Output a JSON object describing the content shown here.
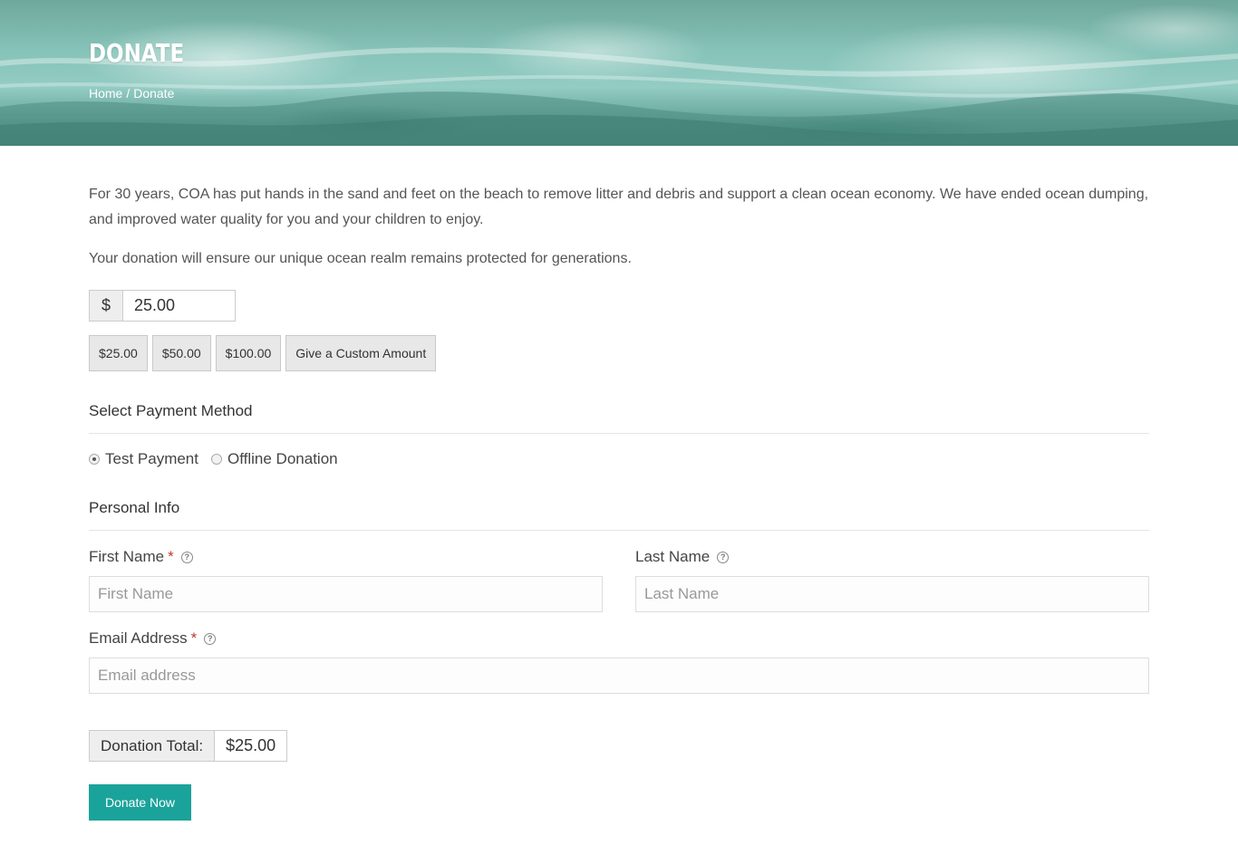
{
  "hero": {
    "title": "DONATE",
    "breadcrumb": {
      "home": "Home",
      "separator": "/",
      "current": "Donate"
    }
  },
  "intro": {
    "paragraph1": "For 30 years, COA has put hands in the sand and feet on the beach to remove litter and debris and support a clean ocean economy. We have ended ocean dumping, and improved water quality for you and your children to enjoy.",
    "paragraph2": "Your donation will ensure our unique ocean realm remains protected for generations."
  },
  "amount": {
    "currency_symbol": "$",
    "value": "25.00"
  },
  "donation_levels": [
    "$25.00",
    "$50.00",
    "$100.00",
    "Give a Custom Amount"
  ],
  "payment": {
    "section_title": "Select Payment Method",
    "methods": [
      {
        "label": "Test Payment",
        "selected": true
      },
      {
        "label": "Offline Donation",
        "selected": false
      }
    ]
  },
  "personal_info": {
    "section_title": "Personal Info",
    "first_name": {
      "label": "First Name",
      "required_mark": "*",
      "placeholder": "First Name"
    },
    "last_name": {
      "label": "Last Name",
      "placeholder": "Last Name"
    },
    "email": {
      "label": "Email Address",
      "required_mark": "*",
      "placeholder": "Email address"
    }
  },
  "total": {
    "label": "Donation Total:",
    "value": "$25.00"
  },
  "submit_label": "Donate Now",
  "colors": {
    "accent": "#1aa39a",
    "required": "#c0392b"
  }
}
